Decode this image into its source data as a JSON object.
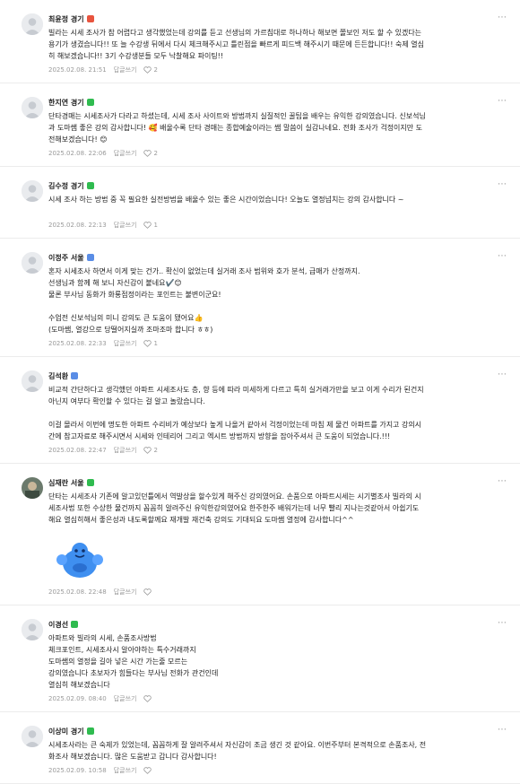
{
  "comments": [
    {
      "nickname": "최윤정 경기",
      "badge": "red",
      "avatar": "default",
      "lines": [
        "빌라는 시세 조사가 참 어렵다고 생각했었는데 강의를 듣고 선생님의 가르침대로 하나하나 해보면 쫄보인 저도 할 수 있겠다는",
        "용기가 생겼습니다!! 또 늘 수강생 뒤에서 다시 체크해주시고 틀린점을 빠르게 피드백 해주시기 때문에 든든합니다!! 숙제 열심",
        "히 해보겠습니다!! 3기 수강생분들 모두 낙찰해요 파이팅!!"
      ],
      "date": "2025.02.08. 21:51",
      "reply_label": "답글쓰기",
      "likes": "2"
    },
    {
      "nickname": "한지연 경기",
      "badge": "green",
      "avatar": "default",
      "lines": [
        "단타경매는 시세조사가 다라고 하셨는데, 시세 조사 사이트와 방법까지 실질적인 꿀팁을 배우는 유익한 강의였습니다. 신보석님",
        "과 도마쌤 좋은 강의 감사합니다! 🥰 배울수록 단타 경매는 종합예술이라는 쌤 말씀이 실감나네요. 전화 조사가 걱정이지만 도",
        "전해보겠습니다! 😊"
      ],
      "date": "2025.02.08. 22:06",
      "reply_label": "답글쓰기",
      "likes": "2"
    },
    {
      "nickname": "김수정 경기",
      "badge": "green",
      "avatar": "default",
      "lines": [
        "시세 조사 하는 방법 중 꼭 필요한 실전방법을 배울수 있는 좋은 시간이었습니다! 오늘도 열정넘치는 강의 감사합니다 ~",
        ""
      ],
      "date": "2025.02.08. 22:13",
      "reply_label": "답글쓰기",
      "likes": "1"
    },
    {
      "nickname": "이정주 서울",
      "badge": "blue",
      "avatar": "default",
      "lines": [
        "혼자 시세조사 하면서 이게 맞는 건가.. 확신이 없었는데 실거래 조사 범위와 호가 분석, 급매가 산정까지.",
        "선생님과 함께 해 보니 자신감이 붙네요✔️😊",
        "물론 부사님 동화가 화룡점정이라는 포인트는 불변이군요!",
        "",
        "수업전 신보석님의 미니 강의도 큰 도움이 됐어요👍",
        "(도마쌤, 열강으로 당떨어지실까 조마조마 합니다 ㅎㅎ)"
      ],
      "date": "2025.02.08. 22:33",
      "reply_label": "답글쓰기",
      "likes": "1"
    },
    {
      "nickname": "김석환",
      "badge": "blue",
      "avatar": "default",
      "lines": [
        "비교적 간단하다고 생각했던 아파트 시세조사도 층, 향 등에 따라 미세하게 다르고 특히 실거래가만을 보고 이게 수리가 된건지",
        "아닌지 여부다 확인할 수 있다는 걸 알고 놀랐습니다.",
        "",
        "이걸 몰라서 이번에 명도한 아파트 수리비가 예상보다 높게 나올거 같아서 걱정이었는데 마침 제 물건 아파트를 가지고 강의시",
        "간에 참고자료로 해주시면서 시세와 인테리어 그리고 엑시트 방법까지 방향을 잡아주셔서 큰 도움이 되었습니다.!!!"
      ],
      "date": "2025.02.08. 22:47",
      "reply_label": "답글쓰기",
      "likes": "2"
    },
    {
      "nickname": "심재란 서울",
      "badge": "green",
      "avatar": "photo",
      "lines": [
        "단타는 시세조사 기존에 알고있던틀에서 역발상을 할수있게 해주신 강의였어요. 손품으로 아파트시세는 시기별조사 빌라의 시",
        "세조사법 또한 수상한 물건까지 꼼꼼히 알려주신 유익한강의였어요 한주한주 배워가는데 너무 빨리 지나는것같아서 아쉽기도",
        "해요 열심히해서 좋은성과 내도록할께요 재개발 재건축 강의도 기대되요 도마쌤 열정에 감사합니다^^"
      ],
      "sticker": true,
      "date": "2025.02.08. 22:48",
      "reply_label": "답글쓰기",
      "likes": ""
    },
    {
      "nickname": "이경선",
      "badge": "green",
      "avatar": "default",
      "lines": [
        "아파트와 빌라의 시세, 손품조사방법",
        "체크포인트, 시세조사시 알아야하는 특수거래까지",
        "도마쌤의 열정을 길아 넣은 시간 가는줄 모르는",
        "강의였습니다 초보자가 힘들다는 부사님 전화가 관건인데",
        "열심히 해보겠습니다"
      ],
      "date": "2025.02.09. 08:40",
      "reply_label": "답글쓰기",
      "likes": ""
    },
    {
      "nickname": "이상미 경기",
      "badge": "green",
      "avatar": "default",
      "lines": [
        "시세조사라는 큰 숙제가 있었는데, 꼼꼼하게 잘 알려주셔서 자신감이 조금 생긴 것 같아요. 이번주부터 본격적으로 손품조사, 전",
        "화조사 해보겠습니다. 많은 도움받고 갑니다 감사합니다!"
      ],
      "date": "2025.02.09. 10:58",
      "reply_label": "답글쓰기",
      "likes": ""
    }
  ]
}
